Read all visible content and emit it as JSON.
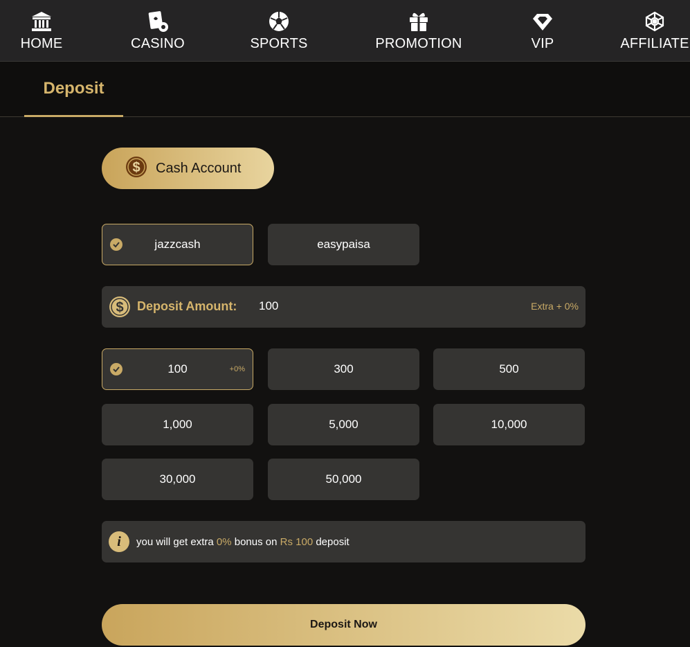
{
  "nav": {
    "items": [
      {
        "label": "HOME",
        "icon": "bank-icon"
      },
      {
        "label": "CASINO",
        "icon": "cards-icon"
      },
      {
        "label": "SPORTS",
        "icon": "soccer-ball-icon"
      },
      {
        "label": "PROMOTION",
        "icon": "gift-icon"
      },
      {
        "label": "VIP",
        "icon": "diamond-icon"
      },
      {
        "label": "AFFILIATE",
        "icon": "network-icon"
      }
    ]
  },
  "tabs": {
    "active": "Deposit"
  },
  "account": {
    "label": "Cash Account",
    "icon": "dollar-coin-icon"
  },
  "payment_methods": {
    "items": [
      {
        "label": "jazzcash",
        "selected": true
      },
      {
        "label": "easypaisa",
        "selected": false
      }
    ]
  },
  "deposit_amount": {
    "label": "Deposit Amount:",
    "value": "100",
    "extra": "Extra + 0%"
  },
  "amount_options": {
    "items": [
      {
        "label": "100",
        "selected": true,
        "bonus": "+0%"
      },
      {
        "label": "300"
      },
      {
        "label": "500"
      },
      {
        "label": "1,000"
      },
      {
        "label": "5,000"
      },
      {
        "label": "10,000"
      },
      {
        "label": "30,000"
      },
      {
        "label": "50,000"
      }
    ]
  },
  "info": {
    "prefix": "you will get extra ",
    "bonus": "0%",
    "middle": " bonus on ",
    "amount": "Rs 100",
    "suffix": " deposit"
  },
  "submit": {
    "label": "Deposit Now"
  },
  "colors": {
    "accent": "#c9aa66",
    "panel": "#353432",
    "background": "#121110",
    "nav": "#252425"
  }
}
